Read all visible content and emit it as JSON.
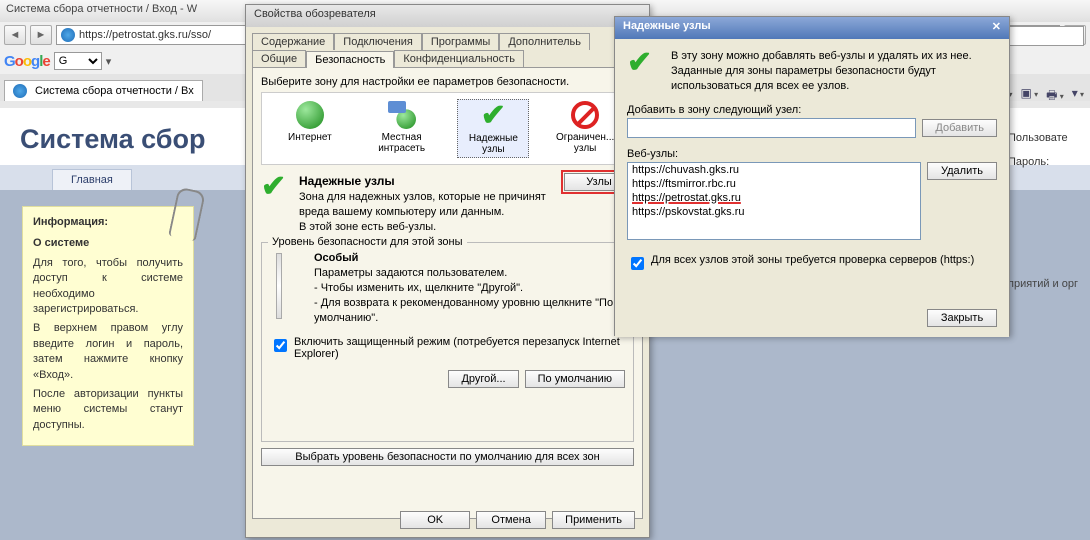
{
  "browser": {
    "window_title": "Система сбора отчетности / Вход - W",
    "url": "https://petrostat.gks.ru/sso/",
    "search_placeholder": "Google",
    "google_label": "Google",
    "google_selector": "G",
    "tab_title": "Система сбора отчетности / Вх"
  },
  "page": {
    "title": "Система сбор",
    "nav_tab": "Главная",
    "info_header": "Информация:",
    "about_header": "О системе",
    "p1": "Для того, чтобы получить доступ к системе необходимо зарегистрироваться.",
    "p2": "В верхнем правом углу введите логин и пароль, затем нажмите кнопку «Вход».",
    "p3": "После авторизации пункты меню системы станут доступны."
  },
  "right_panel": {
    "user_label": "Пользовате",
    "pass_label": "Пароль:",
    "cut_text": "приятий и орг"
  },
  "opt_dialog": {
    "title": "Свойства обозревателя",
    "tabs_row1": [
      "Содержание",
      "Подключения",
      "Программы",
      "Дополнительь"
    ],
    "tabs_row2": [
      "Общие",
      "Безопасность",
      "Конфиденциальность"
    ],
    "active_tab": "Безопасность",
    "zone_prompt": "Выберите зону для настройки ее параметров безопасности.",
    "zones": [
      {
        "label": "Интернет"
      },
      {
        "label": "Местная интрасеть"
      },
      {
        "label": "Надежные узлы"
      },
      {
        "label": "Ограничен... узлы"
      }
    ],
    "zone_title": "Надежные узлы",
    "zone_desc1": "Зона для надежных узлов, которые не причинят вреда вашему компьютеру или данным.",
    "zone_desc2": "В этой зоне есть веб-узлы.",
    "sites_btn": "Узлы",
    "sec_group": "Уровень безопасности для этой зоны",
    "sec_level": "Особый",
    "sec_l1": "Параметры задаются пользователем.",
    "sec_l2": "- Чтобы изменить их, щелкните \"Другой\".",
    "sec_l3": "- Для возврата к рекомендованному уровню щелкните \"По умолчанию\".",
    "protected_mode": "Включить защищенный режим (потребуется перезапуск Internet Explorer)",
    "btn_custom": "Другой...",
    "btn_default": "По умолчанию",
    "btn_reset": "Выбрать уровень безопасности по умолчанию для всех зон",
    "btn_ok": "OK",
    "btn_cancel": "Отмена",
    "btn_apply": "Применить"
  },
  "ts_dialog": {
    "title": "Надежные узлы",
    "intro": "В эту зону можно добавлять веб-узлы и удалять их из нее. Заданные для зоны параметры безопасности будут использоваться для всех ее узлов.",
    "add_label": "Добавить в зону следующий узел:",
    "add_btn": "Добавить",
    "list_label": "Веб-узлы:",
    "remove_btn": "Удалить",
    "items": [
      "https://chuvash.gks.ru",
      "https://ftsmirror.rbc.ru",
      "https://petrostat.gks.ru",
      "https://pskovstat.gks.ru"
    ],
    "https_check": "Для всех узлов этой зоны требуется проверка серверов (https:)",
    "close_btn": "Закрыть"
  }
}
